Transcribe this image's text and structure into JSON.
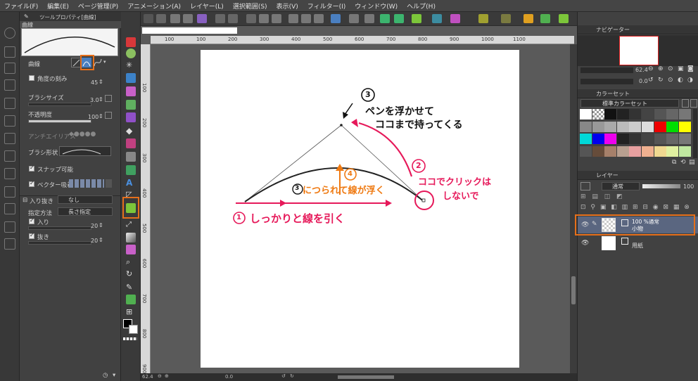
{
  "menu": [
    "ファイル(F)",
    "編集(E)",
    "ページ管理(P)",
    "アニメーション(A)",
    "レイヤー(L)",
    "選択範囲(S)",
    "表示(V)",
    "フィルター(I)",
    "ウィンドウ(W)",
    "ヘルプ(H)"
  ],
  "tool_property": {
    "tab_label": "ツールプロパティ[曲線]",
    "subtool_name": "曲線",
    "curve_label": "曲線",
    "angle_step_label": "角度の刻み",
    "angle_step_value": "45",
    "brush_size_label": "ブラシサイズ",
    "brush_size_value": "3.0",
    "opacity_label": "不透明度",
    "opacity_value": "100",
    "antialias_label": "アンチエイリアス",
    "brush_shape_label": "ブラシ形状",
    "snap_label": "スナップ可能",
    "vector_snap_label": "ベクター吸着",
    "taper_label": "入り抜き",
    "taper_value": "なし",
    "spec_method_label": "指定方法",
    "spec_method_value": "長さ指定",
    "in_label": "入り",
    "in_value": "20",
    "out_label": "抜き",
    "out_value": "20"
  },
  "navigator": {
    "title": "ナビゲーター",
    "zoom_value": "62.4",
    "rotate_value": "0.0"
  },
  "color_set": {
    "title": "カラーセット",
    "set_name": "標準カラーセット",
    "colors": [
      "#ffffff",
      "#c8c8c8",
      "#111111",
      "#222222",
      "#333333",
      "#444444",
      "#555555",
      "#666666",
      "#777777",
      "#888888",
      "#999999",
      "#aaaaaa",
      "#bbbbbb",
      "#cccccc",
      "#dddddd",
      "#ee0000",
      "#00dd00",
      "#ffff00",
      "#00d8d8",
      "#0000ee",
      "#ee00ee",
      "#222222",
      "#333333",
      "#444444",
      "#555555",
      "#666666",
      "#777777",
      "#555555",
      "#664c3a",
      "#a6806a",
      "#b8a090",
      "#e8a0a0",
      "#f0b090",
      "#f0d890",
      "#e0f0a0",
      "#c0e8a0"
    ]
  },
  "layer_panel": {
    "title": "レイヤー",
    "blend_mode": "通常",
    "opacity": "100",
    "layers": [
      {
        "info": "100 %通常",
        "name": "小物",
        "selected": true
      },
      {
        "info": "",
        "name": "用紙",
        "selected": false
      }
    ]
  },
  "annotations": {
    "step1": "しっかりと線を引く",
    "step2_line1": "ココでクリックは",
    "step2_line2": "しないで",
    "step3_line1": "ペンを浮かせて",
    "step3_line2": "ココまで持ってくる",
    "step4": "につられて線が浮く",
    "num1": "1",
    "num2": "2",
    "num3": "3",
    "num4": "4",
    "colors": {
      "pink": "#e6195a",
      "orange": "#ef7a12"
    }
  },
  "ruler": {
    "h_ticks": [
      "100",
      "100",
      "200",
      "300",
      "400",
      "500",
      "600",
      "700",
      "800",
      "900",
      "1000",
      "1100"
    ],
    "v_ticks": [
      "100",
      "200",
      "300",
      "400",
      "500",
      "600",
      "700",
      "800",
      "900"
    ]
  },
  "status": {
    "zoom": "62.4",
    "angle": "0.0"
  },
  "theme": {
    "highlight": "#e56f1b"
  }
}
